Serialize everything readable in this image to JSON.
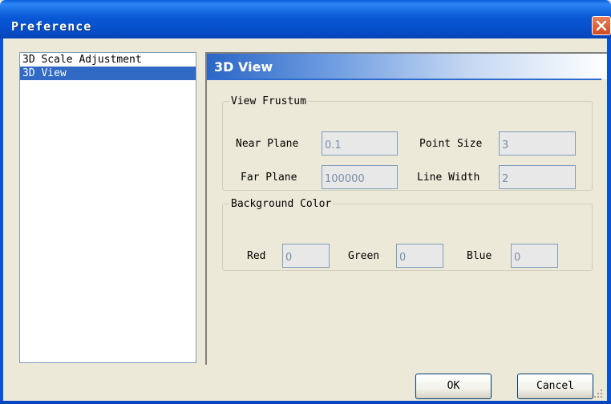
{
  "window": {
    "title": "Preference"
  },
  "sidebar": {
    "items": [
      {
        "label": "3D Scale Adjustment",
        "selected": false
      },
      {
        "label": "3D View",
        "selected": true
      }
    ]
  },
  "panel": {
    "title": "3D View",
    "frustum": {
      "legend": "View Frustum",
      "near_plane": {
        "label": "Near Plane",
        "value": "0.1"
      },
      "far_plane": {
        "label": "Far Plane",
        "value": "100000"
      },
      "point_size": {
        "label": "Point Size",
        "value": "3"
      },
      "line_width": {
        "label": "Line Width",
        "value": "2"
      }
    },
    "background": {
      "legend": "Background Color",
      "red": {
        "label": "Red",
        "value": "0"
      },
      "green": {
        "label": "Green",
        "value": "0"
      },
      "blue": {
        "label": "Blue",
        "value": "0"
      }
    }
  },
  "buttons": {
    "ok": "OK",
    "cancel": "Cancel"
  },
  "colors": {
    "titlebar": "#0a58d6",
    "selection": "#316ac5",
    "close": "#d24a22"
  }
}
